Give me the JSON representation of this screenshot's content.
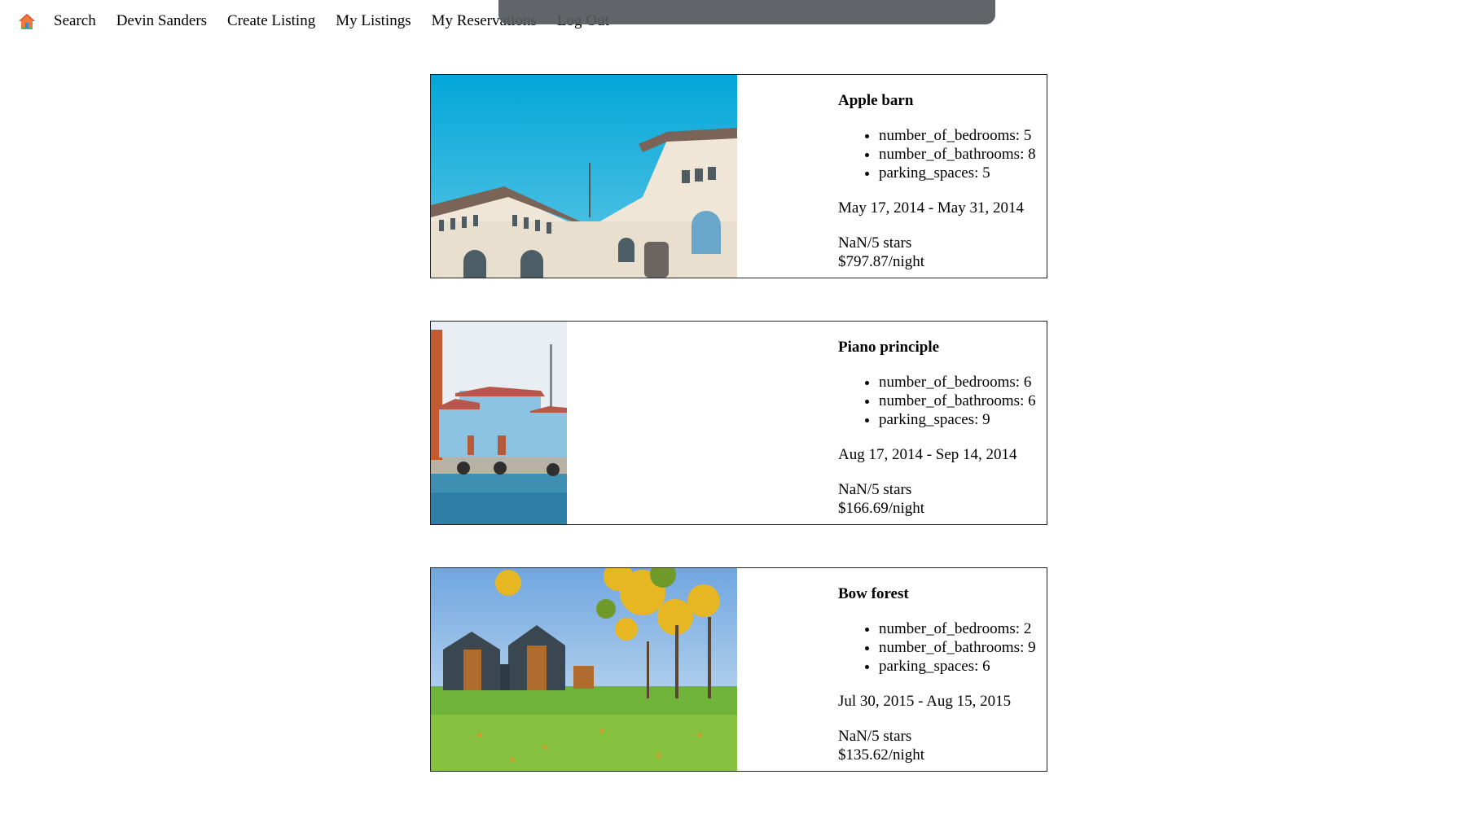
{
  "nav": {
    "home_icon": "house-icon",
    "items": [
      {
        "label": "Search"
      },
      {
        "label": "Devin Sanders"
      },
      {
        "label": "Create Listing"
      },
      {
        "label": "My Listings"
      },
      {
        "label": "My Reservations"
      },
      {
        "label": "Log Out"
      }
    ]
  },
  "colors": {
    "toast_bg": "#55585c",
    "card_border": "#222222"
  },
  "listings": [
    {
      "title": "Apple barn",
      "image": "white-historic-building-photo",
      "features": [
        "number_of_bedrooms: 5",
        "number_of_bathrooms: 8",
        "parking_spaces: 5"
      ],
      "dates": "May 17, 2014 - May 31, 2014",
      "rating": "NaN/5 stars",
      "price": "$797.87/night"
    },
    {
      "title": "Piano principle",
      "image": "blue-waterfront-building-photo",
      "features": [
        "number_of_bedrooms: 6",
        "number_of_bathrooms: 6",
        "parking_spaces: 9"
      ],
      "dates": "Aug 17, 2014 - Sep 14, 2014",
      "rating": "NaN/5 stars",
      "price": "$166.69/night"
    },
    {
      "title": "Bow forest",
      "image": "modern-barn-houses-autumn-photo",
      "features": [
        "number_of_bedrooms: 2",
        "number_of_bathrooms: 9",
        "parking_spaces: 6"
      ],
      "dates": "Jul 30, 2015 - Aug 15, 2015",
      "rating": "NaN/5 stars",
      "price": "$135.62/night"
    }
  ]
}
